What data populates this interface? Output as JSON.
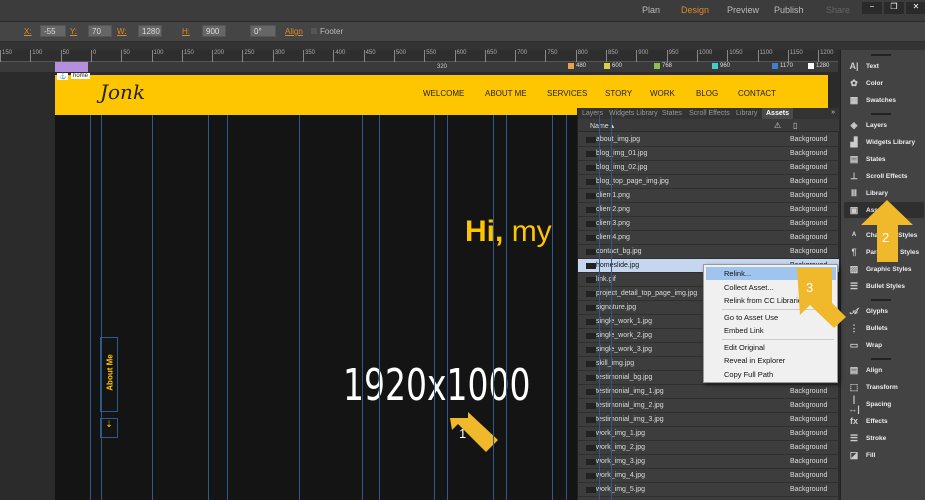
{
  "workspace": {
    "tabs": [
      "Plan",
      "Design",
      "Preview",
      "Publish",
      "Share"
    ],
    "active": "Design"
  },
  "controls": {
    "x_label": "X:",
    "x": "-55",
    "y_label": "Y:",
    "y": "70",
    "w_label": "W:",
    "w": "1280",
    "h_label": "H:",
    "h": "900",
    "angle": "0°",
    "align": "Align",
    "footer": "Footer"
  },
  "ruler": [
    "150",
    "100",
    "50",
    "0",
    "50",
    "100",
    "150",
    "200",
    "250",
    "300",
    "350",
    "400",
    "450",
    "500",
    "550",
    "600",
    "650",
    "700",
    "750",
    "800",
    "850",
    "900",
    "950",
    "1000",
    "1050",
    "1100",
    "1150",
    "1200"
  ],
  "breakpoints": [
    {
      "label": "480",
      "color": "#e8a04a"
    },
    {
      "label": "600",
      "color": "#d8cf4a"
    },
    {
      "label": "768",
      "color": "#8cc04a"
    },
    {
      "label": "960",
      "color": "#3ed0c8"
    },
    {
      "label": "1170",
      "color": "#3f7fd0"
    },
    {
      "label": "1280",
      "color": "#ffffff"
    }
  ],
  "breakpoint_mid": "320",
  "site": {
    "anchor": "home",
    "logo": "Jonk",
    "nav": [
      "WELCOME",
      "ABOUT ME",
      "SERVICES",
      "STORY",
      "WORK",
      "BLOG",
      "CONTACT"
    ],
    "hero": "Hi,",
    "hero_rest": "my",
    "dimension": "1920x1000",
    "about": "About Me"
  },
  "panel": {
    "tabs": [
      "Layers",
      "Widgets Library",
      "States",
      "Scroll Effects",
      "Library",
      "Assets"
    ],
    "active": "Assets",
    "col_name": "Name ▴",
    "assets": [
      "about_img.jpg",
      "blog_img_01.jpg",
      "blog_img_02.jpg",
      "blog_top_page_img.jpg",
      "client1.png",
      "client2.png",
      "client3.png",
      "client4.png",
      "contact_bg.jpg",
      "homeslide.jpg",
      "link.gif",
      "project_detail_top_page_img.jpg",
      "signature.jpg",
      "single_work_1.jpg",
      "single_work_2.jpg",
      "single_work_3.jpg",
      "skill_img.jpg",
      "testimonial_bg.jpg",
      "testimonial_img_1.jpg",
      "testimonial_img_2.jpg",
      "testimonial_img_3.jpg",
      "work_img_1.jpg",
      "work_img_2.jpg",
      "work_img_3.jpg",
      "work_img_4.jpg",
      "work_img_5.jpg"
    ],
    "type": "Background",
    "selected": "homeslide.jpg"
  },
  "context_menu": [
    [
      "Relink...",
      "Collect Asset...",
      "Relink from CC Libraries"
    ],
    [
      "Go to Asset Use",
      "Embed Link"
    ],
    [
      "Edit Original",
      "Reveal in Explorer",
      "Copy Full Path"
    ]
  ],
  "sidebar": [
    [
      "Text",
      "Color",
      "Swatches"
    ],
    [
      "Layers",
      "Widgets Library",
      "States",
      "Scroll Effects",
      "Library",
      "Assets"
    ],
    [
      "Character Styles",
      "Paragraph Styles",
      "Graphic Styles",
      "Bullet Styles"
    ],
    [
      "Glyphs",
      "Bullets",
      "Wrap"
    ],
    [
      "Align",
      "Transform",
      "Spacing",
      "Effects",
      "Stroke",
      "Fill"
    ]
  ],
  "sidebar_icons": [
    [
      "A|",
      "✿",
      "▦"
    ],
    [
      "◈",
      "▟",
      "▤",
      "⊥",
      "Ⅲ",
      "▣"
    ],
    [
      "ᴬ",
      "¶",
      "▨",
      "☰"
    ],
    [
      "𝒜",
      "⋮",
      "▭"
    ],
    [
      "▤",
      "⬚",
      "|↔|",
      "fx",
      "☰",
      "◪"
    ]
  ],
  "annotations": [
    "1",
    "2",
    "3"
  ],
  "accent": "#fec601"
}
